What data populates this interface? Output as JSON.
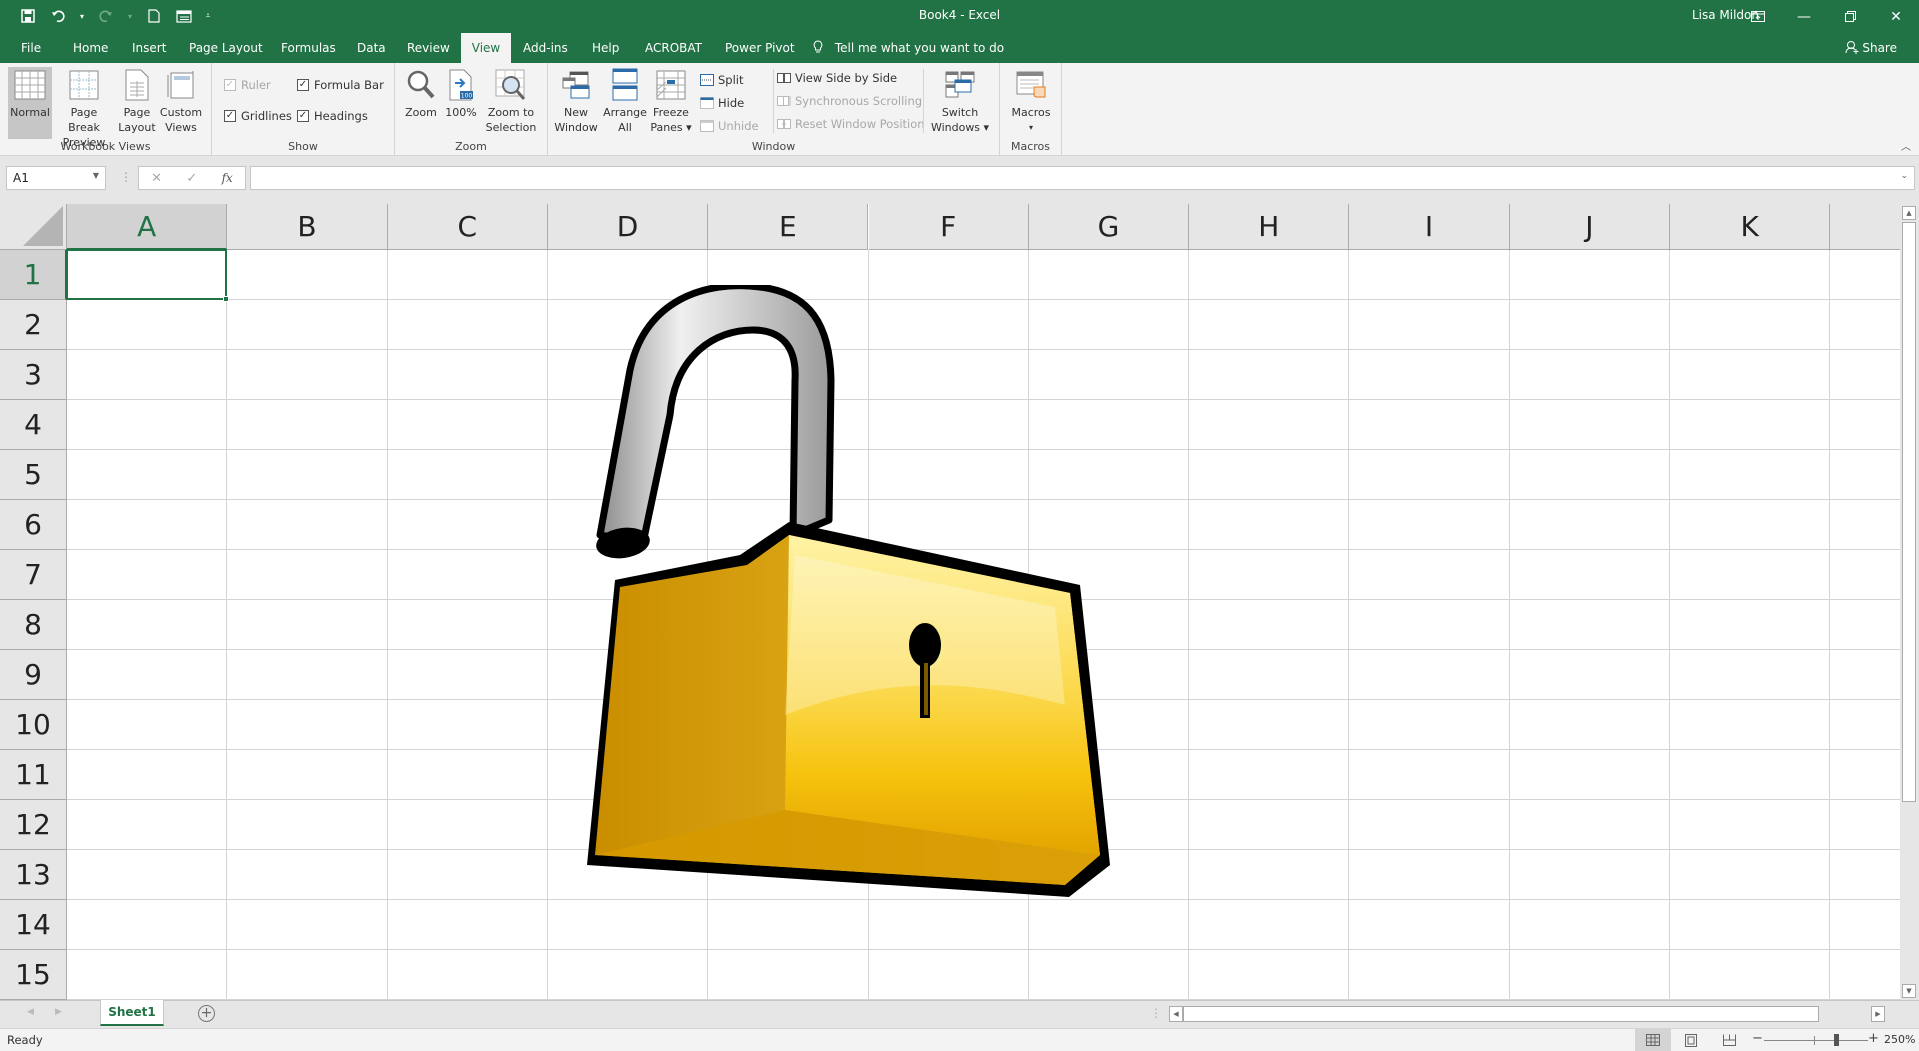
{
  "titlebar": {
    "title": "Book4  -  Excel",
    "user": "Lisa Mildon",
    "qat": [
      "save-icon",
      "undo-icon",
      "redo-icon",
      "new-document-icon",
      "form-icon",
      "customize-qat-icon"
    ],
    "window_buttons": [
      "ribbon-display-options-icon",
      "minimize-icon",
      "restore-icon",
      "close-icon"
    ]
  },
  "tabs": [
    {
      "label": "File"
    },
    {
      "label": "Home"
    },
    {
      "label": "Insert"
    },
    {
      "label": "Page Layout"
    },
    {
      "label": "Formulas"
    },
    {
      "label": "Data"
    },
    {
      "label": "Review"
    },
    {
      "label": "View",
      "active": true
    },
    {
      "label": "Add-ins"
    },
    {
      "label": "Help"
    },
    {
      "label": "ACROBAT"
    },
    {
      "label": "Power Pivot"
    }
  ],
  "tell_me": "Tell me what you want to do",
  "share": "Share",
  "ribbon": {
    "workbook_views": {
      "label": "Workbook Views",
      "buttons": [
        {
          "line1": "Normal",
          "line2": "",
          "selected": true
        },
        {
          "line1": "Page Break",
          "line2": "Preview"
        },
        {
          "line1": "Page",
          "line2": "Layout"
        },
        {
          "line1": "Custom",
          "line2": "Views"
        }
      ]
    },
    "show": {
      "label": "Show",
      "ruler": {
        "label": "Ruler",
        "checked": true,
        "disabled": true
      },
      "formula_bar": {
        "label": "Formula Bar",
        "checked": true
      },
      "gridlines": {
        "label": "Gridlines",
        "checked": true
      },
      "headings": {
        "label": "Headings",
        "checked": true
      }
    },
    "zoom": {
      "label": "Zoom",
      "buttons": [
        {
          "line1": "Zoom",
          "line2": ""
        },
        {
          "line1": "100%",
          "line2": ""
        },
        {
          "line1": "Zoom to",
          "line2": "Selection"
        }
      ]
    },
    "window": {
      "label": "Window",
      "buttons": [
        {
          "line1": "New",
          "line2": "Window"
        },
        {
          "line1": "Arrange",
          "line2": "All"
        },
        {
          "line1": "Freeze",
          "line2": "Panes ▾"
        }
      ],
      "split": "Split",
      "hide": "Hide",
      "unhide": "Unhide",
      "view_side_by_side": "View Side by Side",
      "synchronous_scrolling": "Synchronous Scrolling",
      "reset_window_position": "Reset Window Position",
      "switch_windows": {
        "line1": "Switch",
        "line2": "Windows ▾"
      }
    },
    "macros": {
      "label": "Macros",
      "button": {
        "line1": "Macros",
        "line2": "▾"
      }
    }
  },
  "formula_bar": {
    "name_box": "A1",
    "cancel": "✕",
    "enter": "✓",
    "fx": "fx",
    "formula": ""
  },
  "grid": {
    "columns": [
      "A",
      "B",
      "C",
      "D",
      "E",
      "F",
      "G",
      "H",
      "I",
      "J",
      "K"
    ],
    "rows": [
      "1",
      "2",
      "3",
      "4",
      "5",
      "6",
      "7",
      "8",
      "9",
      "10",
      "11",
      "12",
      "13",
      "14",
      "15"
    ],
    "selected_cell": "A1",
    "image": "unlocked-padlock-picture"
  },
  "sheets": [
    {
      "name": "Sheet1",
      "active": true
    }
  ],
  "status": {
    "text": "Ready",
    "zoom": "250%",
    "views": [
      "normal-view-icon",
      "page-layout-view-icon",
      "page-break-preview-icon"
    ]
  },
  "colors": {
    "accent": "#217346",
    "ribbon_bg": "#f3f3f3",
    "header_bg": "#e6e6e6",
    "gridline": "#d4d4d4",
    "lock_body": "#f5c518",
    "shackle": "#b8b8b8"
  }
}
